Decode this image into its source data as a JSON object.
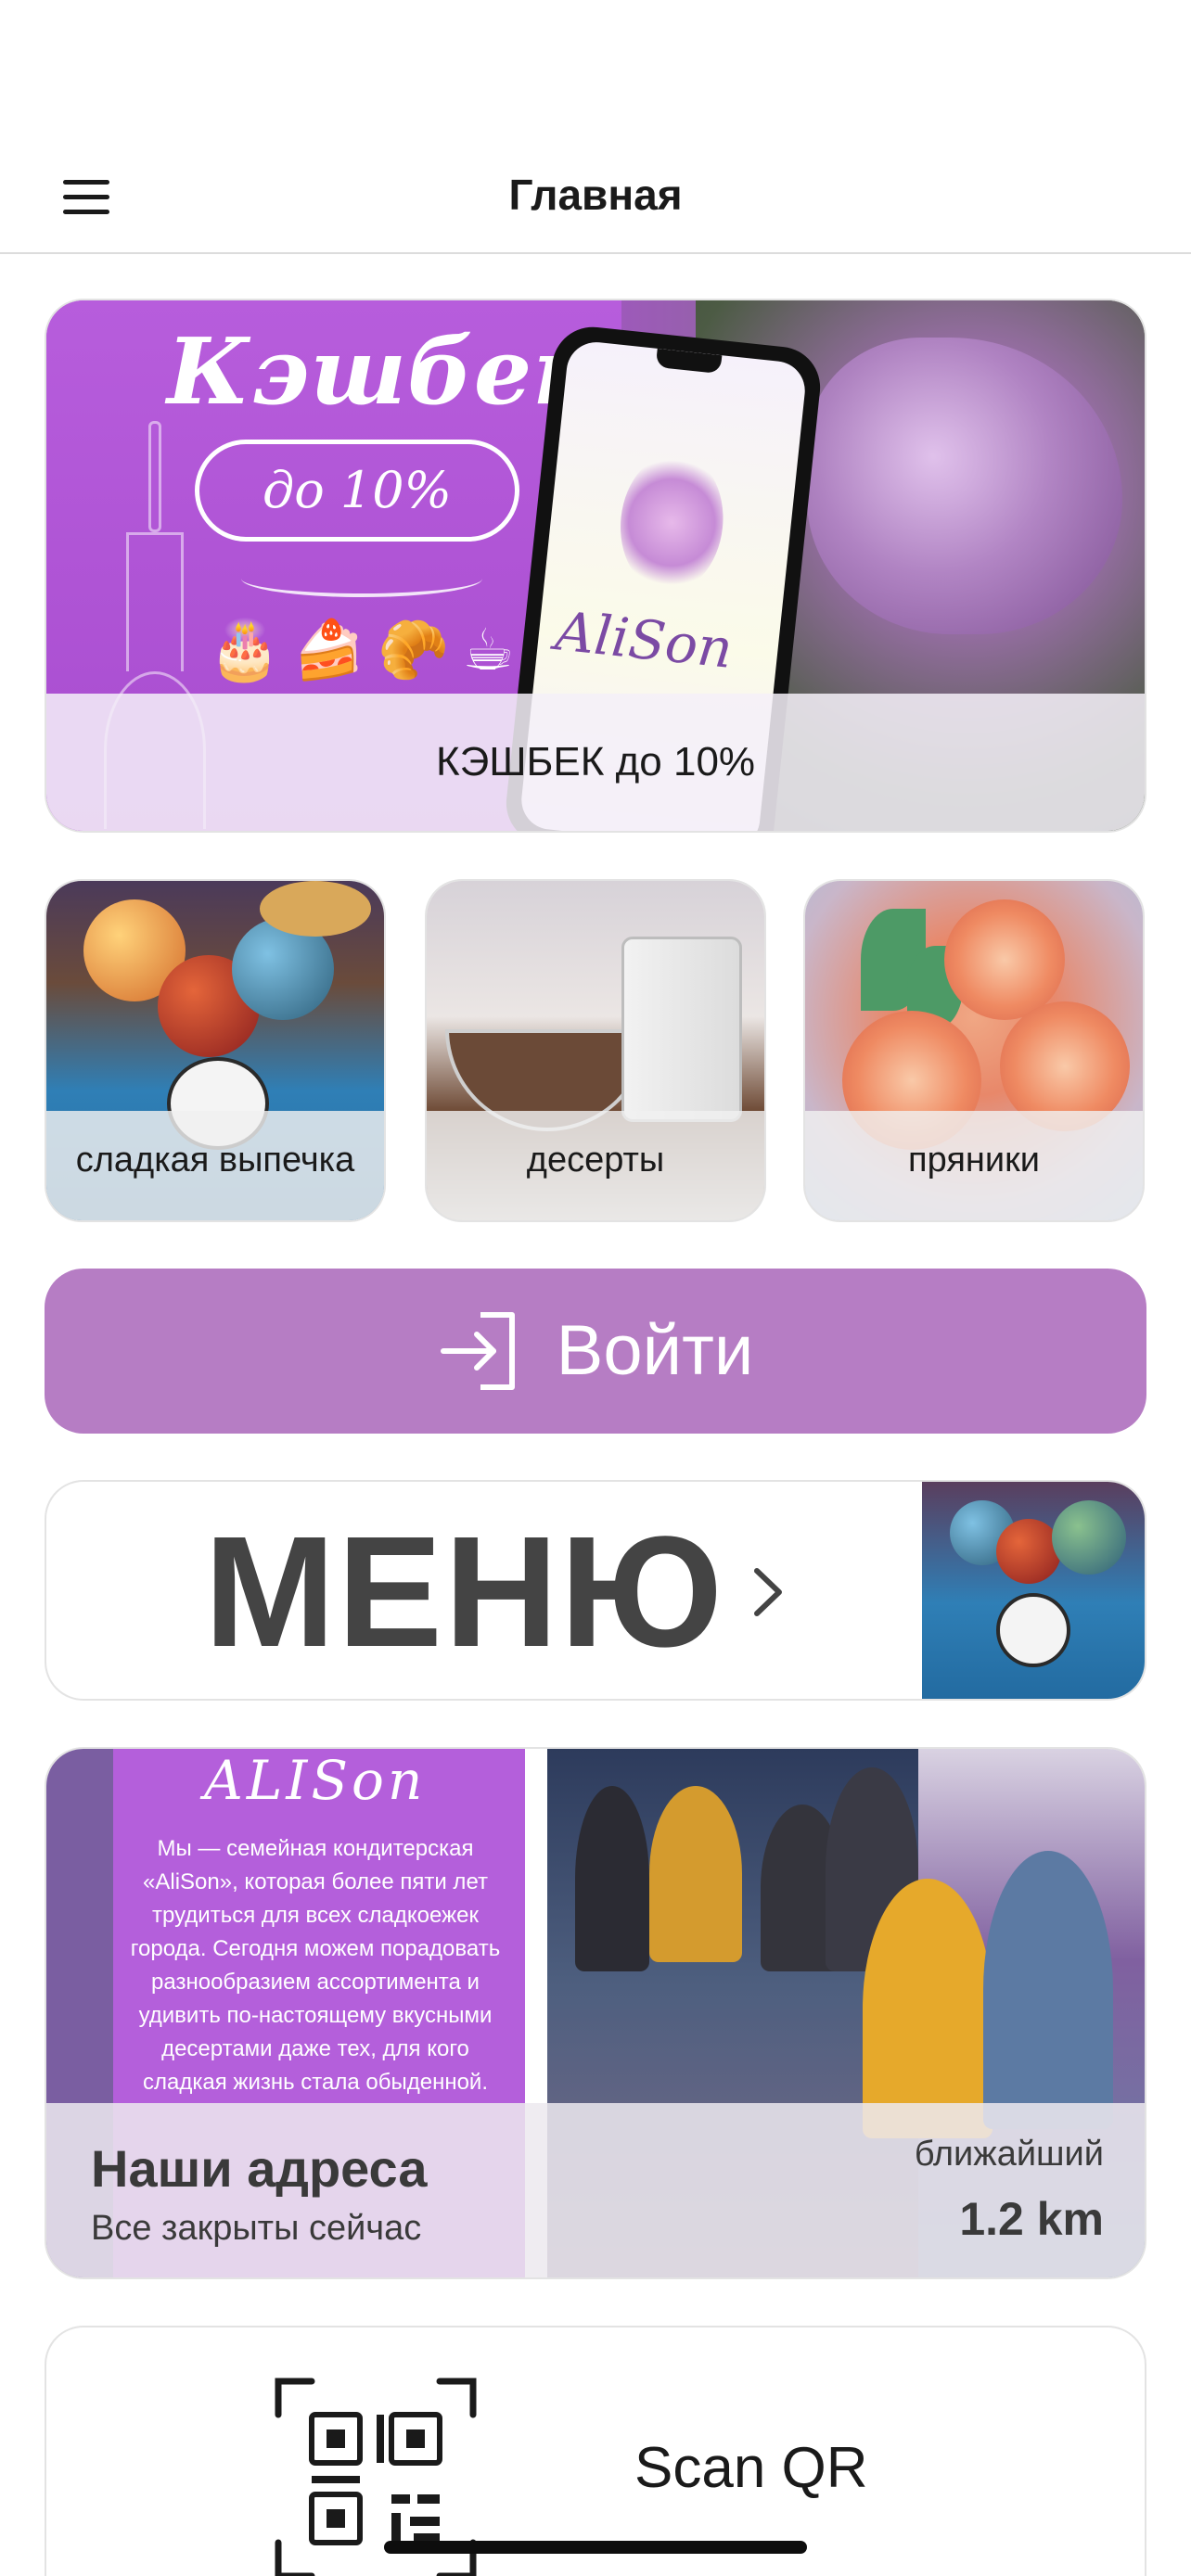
{
  "header": {
    "title": "Главная"
  },
  "banner": {
    "headline": "Кэшбек",
    "pill_text": "до 10%",
    "phone_logo": "AliSon",
    "caption": "КЭШБЕК до 10%"
  },
  "categories": [
    {
      "label": "сладкая выпечка"
    },
    {
      "label": "десерты"
    },
    {
      "label": "пряники"
    }
  ],
  "login": {
    "label": "Войти"
  },
  "menu": {
    "label": "МЕНЮ"
  },
  "addresses": {
    "photo_script": "ALISon",
    "photo_text": "Мы — семейная кондитерская «AliSon», которая более пяти лет трудиться для всех сладкоежек города. Сегодня можем порадовать разнообразием ассортимента и удивить по-настоящему вкусными десертами даже тех, для кого сладкая жизнь стала обыденной.",
    "title": "Наши адреса",
    "status": "Все закрыты сейчас",
    "nearest_label": "ближайший",
    "nearest_distance": "1.2 km"
  },
  "scan": {
    "label": "Scan QR"
  },
  "colors": {
    "accent": "#b67dc4",
    "banner_purple": "#b44fd8",
    "text": "#1a1a1a"
  },
  "icons": [
    "hamburger-menu-icon",
    "login-arrow-icon",
    "chevron-right-icon",
    "qr-code-icon"
  ]
}
